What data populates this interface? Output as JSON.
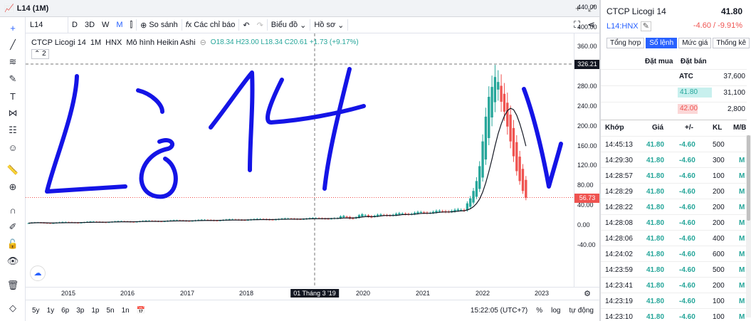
{
  "window": {
    "title": "L14 (1M)"
  },
  "toolbar": {
    "symbol": "L14",
    "intervals": [
      "D",
      "3D",
      "W",
      "M"
    ],
    "active_interval": "M",
    "compare": "So sánh",
    "indicators": "Các chỉ báo",
    "chart_type": "Biểu đồ",
    "profile": "Hồ sơ"
  },
  "legend": {
    "name": "CTCP Licogi 14",
    "interval": "1M",
    "exchange": "HNX",
    "chart_style": "Mô hình Heikin Ashi",
    "open": "O18.34",
    "high": "H23.00",
    "low": "L18.34",
    "close": "C20.61",
    "change": "+1.73 (+9.17%)",
    "badge": "2"
  },
  "yaxis": {
    "ticks": [
      "440.00",
      "400.00",
      "360.00",
      "320.00",
      "280.00",
      "240.00",
      "200.00",
      "160.00",
      "120.00",
      "80.00",
      "40.00",
      "0.00",
      "-40.00"
    ],
    "crosshair_price": "326.21",
    "last_price": "56.73"
  },
  "xaxis": {
    "ticks": [
      "2015",
      "2016",
      "2017",
      "2018",
      "2020",
      "2021",
      "2022",
      "2023"
    ],
    "crosshair_date": "01 Tháng 3 '19"
  },
  "bottom": {
    "ranges": [
      "5y",
      "1y",
      "6p",
      "3p",
      "1p",
      "5n",
      "1n"
    ],
    "time": "15:22:05 (UTC+7)",
    "pct": "%",
    "log": "log",
    "auto": "tự động"
  },
  "annotation": {
    "text": "Lò 14",
    "color": "#1414e6"
  },
  "colors": {
    "up": "#26a69a",
    "down": "#ef5350",
    "accent": "#2962ff"
  },
  "panel": {
    "name": "CTCP Licogi 14",
    "price": "41.80",
    "symbol": "L14:HNX",
    "change": "-4.60 / -9.91%",
    "tabs": [
      "Tổng hợp",
      "Sổ lệnh",
      "Mức giá",
      "Thống kê"
    ],
    "active_tab": "Sổ lệnh",
    "book_headers": [
      "Đặt mua",
      "Đặt bán"
    ],
    "book_rows": [
      {
        "price": "ATC",
        "vol": "37,600"
      },
      {
        "price": "41.80",
        "vol": "31,100"
      },
      {
        "price": "42.00",
        "vol": "2,800"
      }
    ],
    "trade_headers": [
      "Khớp",
      "Giá",
      "+/-",
      "KL",
      "M/B"
    ],
    "trades": [
      {
        "t": "14:45:13",
        "p": "41.80",
        "c": "-4.60",
        "v": "500",
        "s": ""
      },
      {
        "t": "14:29:30",
        "p": "41.80",
        "c": "-4.60",
        "v": "300",
        "s": "M"
      },
      {
        "t": "14:28:57",
        "p": "41.80",
        "c": "-4.60",
        "v": "100",
        "s": "M"
      },
      {
        "t": "14:28:29",
        "p": "41.80",
        "c": "-4.60",
        "v": "200",
        "s": "M"
      },
      {
        "t": "14:28:22",
        "p": "41.80",
        "c": "-4.60",
        "v": "200",
        "s": "M"
      },
      {
        "t": "14:28:08",
        "p": "41.80",
        "c": "-4.60",
        "v": "200",
        "s": "M"
      },
      {
        "t": "14:28:06",
        "p": "41.80",
        "c": "-4.60",
        "v": "400",
        "s": "M"
      },
      {
        "t": "14:24:02",
        "p": "41.80",
        "c": "-4.60",
        "v": "600",
        "s": "M"
      },
      {
        "t": "14:23:59",
        "p": "41.80",
        "c": "-4.60",
        "v": "500",
        "s": "M"
      },
      {
        "t": "14:23:41",
        "p": "41.80",
        "c": "-4.60",
        "v": "200",
        "s": "M"
      },
      {
        "t": "14:23:19",
        "p": "41.80",
        "c": "-4.60",
        "v": "100",
        "s": "M"
      },
      {
        "t": "14:23:10",
        "p": "41.80",
        "c": "-4.60",
        "v": "100",
        "s": "M"
      }
    ]
  }
}
